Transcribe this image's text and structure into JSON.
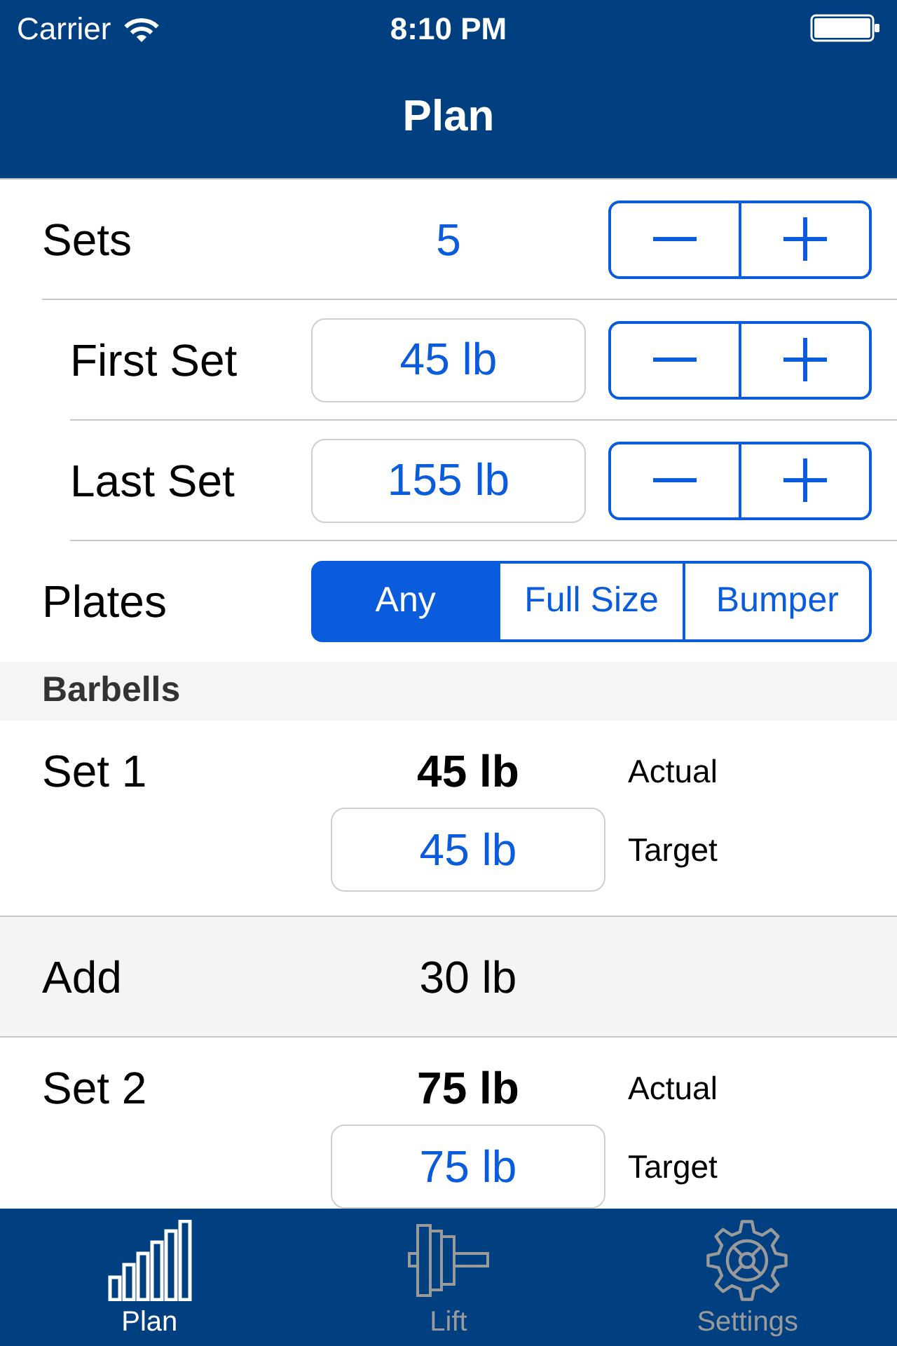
{
  "status_bar": {
    "carrier": "Carrier",
    "time": "8:10 PM"
  },
  "nav_bar": {
    "title": "Plan"
  },
  "settings": [
    {
      "kind": "stepper",
      "label": "Sets",
      "value": "5",
      "children": [
        {
          "kind": "entry",
          "label": "First Set",
          "value": "45 lb"
        },
        {
          "kind": "entry",
          "label": "Last Set",
          "value": "155 lb"
        }
      ]
    },
    {
      "kind": "segmented",
      "label": "Plates",
      "options": [
        {
          "label": "Any",
          "selected": true
        },
        {
          "label": "Full Size",
          "selected": false
        },
        {
          "label": "Bumper",
          "selected": false
        }
      ]
    }
  ],
  "section": {
    "title": "Barbells",
    "rows": [
      {
        "kind": "set",
        "label": "Set 1",
        "actual": "45 lb",
        "actual_caption": "Actual",
        "target": "45 lb",
        "target_caption": "Target"
      },
      {
        "kind": "add",
        "label": "Add",
        "value": "30 lb"
      },
      {
        "kind": "set",
        "label": "Set 2",
        "actual": "75 lb",
        "actual_caption": "Actual",
        "target": "75 lb",
        "target_caption": "Target"
      }
    ]
  },
  "tab_bar": {
    "tabs": [
      {
        "label": "Plan",
        "selected": true
      },
      {
        "label": "Lift",
        "selected": false
      },
      {
        "label": "Settings",
        "selected": false
      }
    ]
  }
}
